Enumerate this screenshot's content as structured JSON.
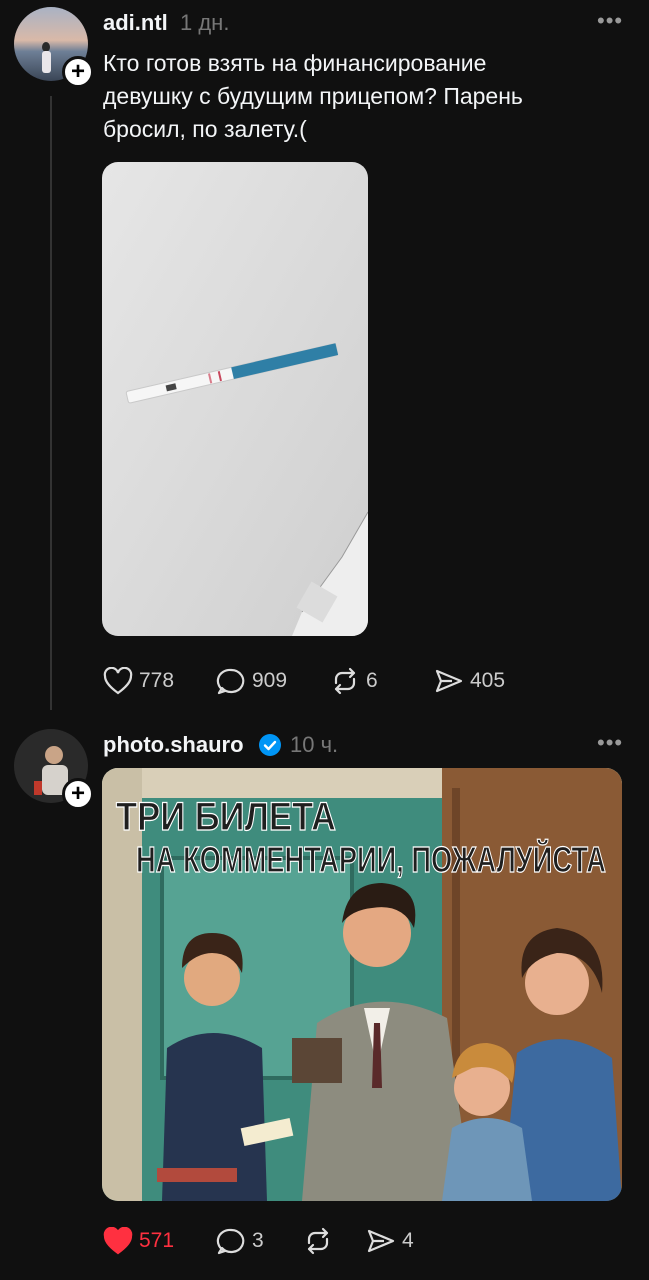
{
  "posts": [
    {
      "username": "adi.ntl",
      "time": "1 дн.",
      "more": "•••",
      "text_lines": [
        "Кто готов взять на финансирование",
        "девушку с будущим прицепом? Парень",
        "бросил, по залету.("
      ],
      "likes": "778",
      "comments": "909",
      "reposts": "6",
      "shares": "405",
      "liked": false
    },
    {
      "username": "photo.shauro",
      "verified": true,
      "time": "10 ч.",
      "more": "•••",
      "poster": {
        "line1": "ТРИ БИЛЕТА",
        "line2": "НА КОММЕНТАРИИ, ПОЖАЛУЙСТА"
      },
      "likes": "571",
      "comments": "3",
      "reposts": "",
      "shares": "4",
      "liked": true,
      "like_color": "#ff3040"
    }
  ],
  "icons": {
    "plus": "+",
    "verified": "verified-badge-icon"
  }
}
